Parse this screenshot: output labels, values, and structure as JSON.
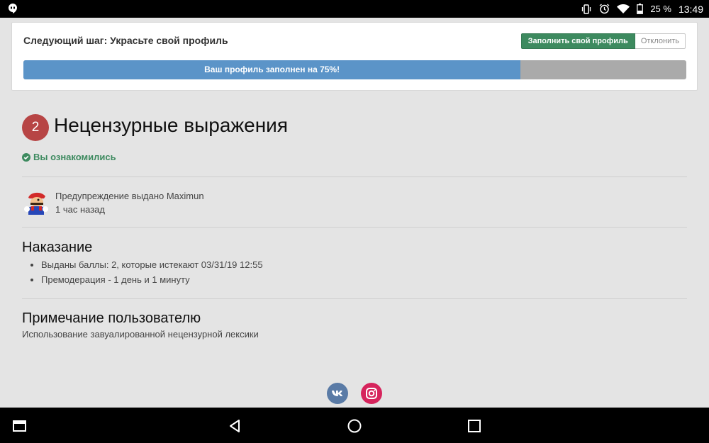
{
  "status_bar": {
    "battery": "25 %",
    "time": "13:49"
  },
  "profile_card": {
    "title": "Следующий шаг: Украсьте свой профиль",
    "fill_button": "Заполнить свой профиль",
    "dismiss_button": "Отклонить",
    "progress_text": "Ваш профиль заполнен на 75%!",
    "progress_fraction": 0.75
  },
  "warning": {
    "points_badge": "2",
    "title": "Нецензурные выражения",
    "acknowledged": "Вы ознакомились",
    "issued_by": "Предупреждение выдано Maximun",
    "issued_ago": "1 час назад"
  },
  "penalty": {
    "title": "Наказание",
    "items": [
      "Выданы баллы: 2, которые истекают 03/31/19 12:55",
      "Премодерация - 1 день и 1 минуту"
    ]
  },
  "user_note": {
    "title": "Примечание пользователю",
    "text": "Использование завуалированной нецензурной лексики"
  },
  "social": [
    {
      "name": "vk-icon",
      "color": "#5a7ba6"
    },
    {
      "name": "instagram-icon",
      "color": "#d6245c"
    }
  ],
  "colors": {
    "accent_green": "#3d8a5f",
    "progress_blue": "#5b94c8",
    "badge_red": "#b74545"
  }
}
